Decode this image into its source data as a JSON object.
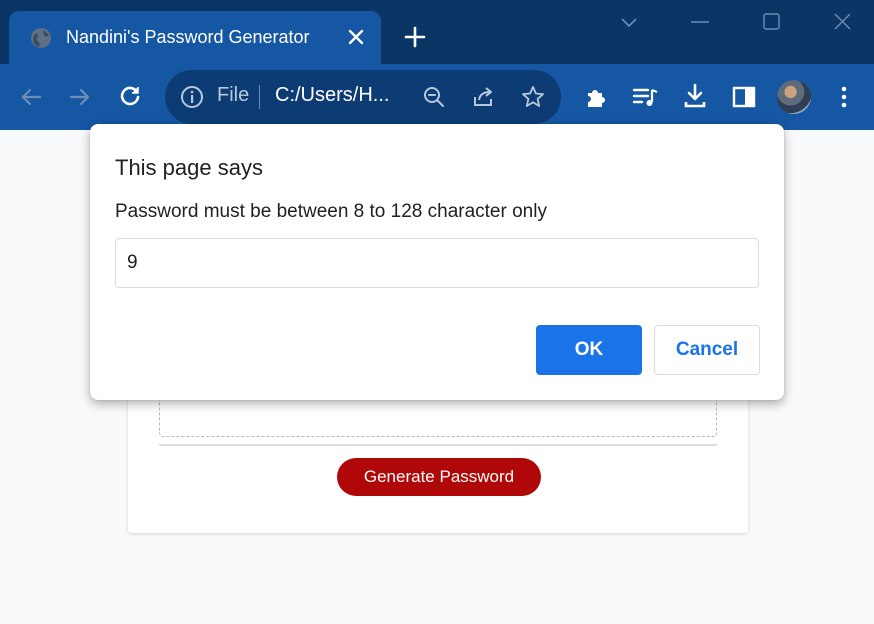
{
  "browser": {
    "tab": {
      "title": "Nandini's Password Generator",
      "favicon": "globe-icon"
    },
    "address_bar": {
      "scheme": "File",
      "url": "C:/Users/H..."
    }
  },
  "dialog": {
    "title": "This page says",
    "message": "Password must be between 8 to 128 character only",
    "input_value": "9",
    "ok_label": "OK",
    "cancel_label": "Cancel"
  },
  "page": {
    "generate_label": "Generate Password"
  },
  "colors": {
    "tab_strip": "#0b3564",
    "toolbar": "#1557a3",
    "accent_blue": "#1a73e8",
    "generate_button": "#b00808"
  }
}
